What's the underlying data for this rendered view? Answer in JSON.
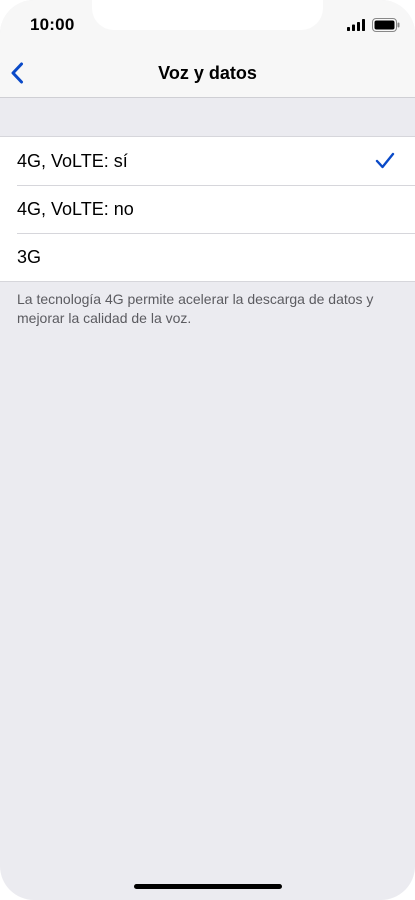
{
  "status_bar": {
    "time": "10:00",
    "signal_icon": "cellular-signal-icon",
    "battery_icon": "battery-full-icon"
  },
  "nav": {
    "back_icon": "chevron-left-icon",
    "title": "Voz y datos"
  },
  "options": [
    {
      "label": "4G, VoLTE: sí",
      "selected": true
    },
    {
      "label": "4G, VoLTE: no",
      "selected": false
    },
    {
      "label": "3G",
      "selected": false
    }
  ],
  "footer": {
    "note": "La tecnología 4G permite acelerar la descarga de datos y mejorar la calidad de la voz."
  },
  "colors": {
    "accent": "#0a4ac8",
    "background": "#ebebf0"
  }
}
